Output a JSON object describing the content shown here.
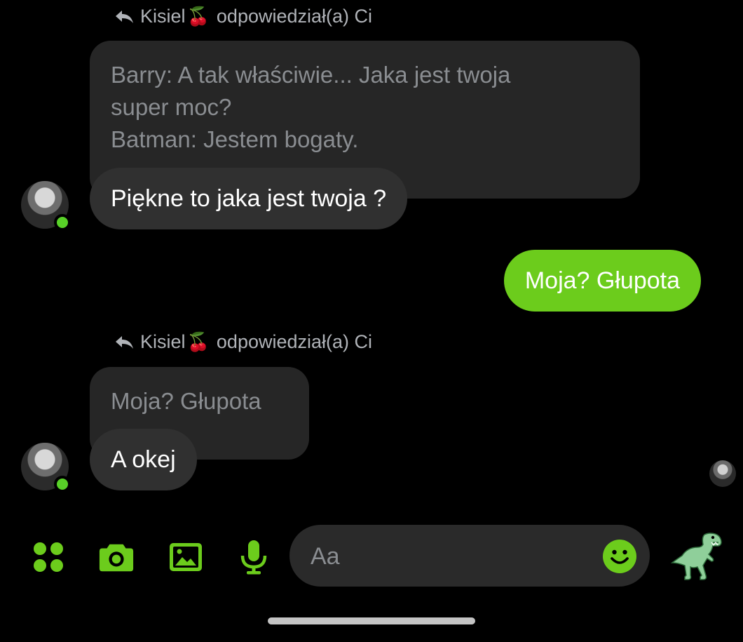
{
  "colors": {
    "accent": "#6ccc1c",
    "background": "#000000",
    "incoming_bubble": "#303030",
    "quoted_bubble": "#262626",
    "online": "#58d128"
  },
  "thread": {
    "reply1": {
      "sender": "Kisiel",
      "sender_emoji": "🍒",
      "action": "odpowiedział(a) Ci",
      "quoted_lines": [
        "Barry: A tak właściwie... Jaka jest twoja",
        "super moc?",
        "Batman: Jestem bogaty."
      ],
      "message": "Piękne to jaka jest twoja ?"
    },
    "outgoing1": {
      "message": "Moja? Głupota"
    },
    "reply2": {
      "sender": "Kisiel",
      "sender_emoji": "🍒",
      "action": "odpowiedział(a) Ci",
      "quoted": "Moja? Głupota",
      "message": "A okej"
    }
  },
  "composer": {
    "placeholder": "Aa",
    "icons": [
      "apps-icon",
      "camera-icon",
      "gallery-icon",
      "microphone-icon",
      "emoji-icon"
    ],
    "quick_reaction": "🦖"
  }
}
